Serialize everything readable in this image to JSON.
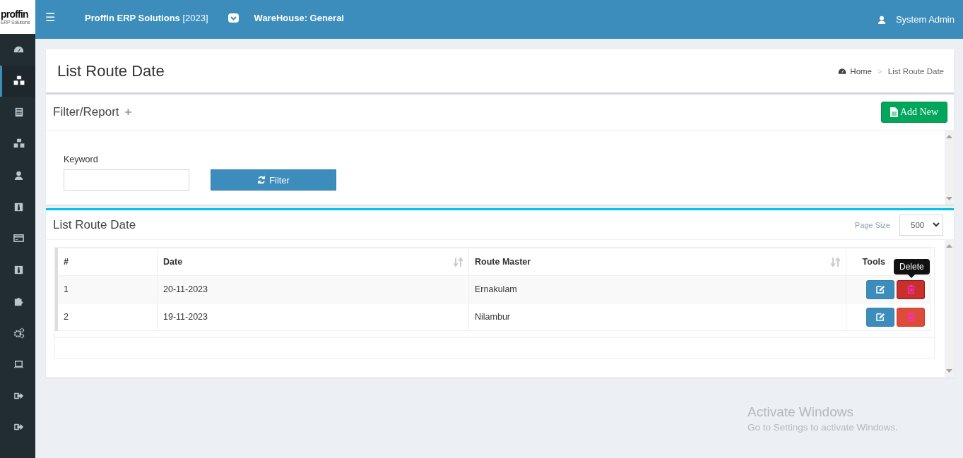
{
  "logo": {
    "name": "proffin",
    "tagline": "ERP Solutions"
  },
  "topbar": {
    "menu_icon": "☰",
    "app_name": "Proffin ERP Solutions",
    "year": "[2023]",
    "warehouse": "WareHouse: General",
    "user": "System Admin"
  },
  "sidebar": {
    "items": [
      {
        "selected": false
      },
      {
        "selected": true
      },
      {
        "selected": false
      },
      {
        "selected": false
      },
      {
        "selected": false
      },
      {
        "selected": false
      },
      {
        "selected": false
      },
      {
        "selected": false
      },
      {
        "selected": false
      },
      {
        "selected": false
      },
      {
        "selected": false
      },
      {
        "selected": false
      },
      {
        "selected": false
      }
    ]
  },
  "page": {
    "title": "List Route Date",
    "breadcrumb": [
      {
        "label": "Home"
      },
      {
        "label": "List Route Date"
      }
    ],
    "breadcrumb_separator": ">"
  },
  "filter_panel": {
    "title": "Filter/Report",
    "expand_icon": "+",
    "add_button": "Add New",
    "keyword": {
      "label": "Keyword"
    },
    "filter_button": "Filter"
  },
  "list_panel": {
    "title": "List Route Date",
    "page_size_label": "Page Size",
    "page_size": "500",
    "table": {
      "columns": [
        {
          "label": "#",
          "sortable": false
        },
        {
          "label": "Date",
          "sortable": true
        },
        {
          "label": "Route Master",
          "sortable": true
        },
        {
          "label": "Tools",
          "sortable": false
        }
      ],
      "rows": [
        {
          "cells": [
            "1",
            "20-11-2023",
            "Ernakulam"
          ],
          "delete_hovered": true
        },
        {
          "cells": [
            "2",
            "19-11-2023",
            "Nilambur"
          ],
          "delete_hovered": false
        }
      ],
      "tooltip": "Delete"
    }
  },
  "windows_notice": {
    "title": "Activate Windows",
    "text": "Go to Settings to activate Windows."
  }
}
